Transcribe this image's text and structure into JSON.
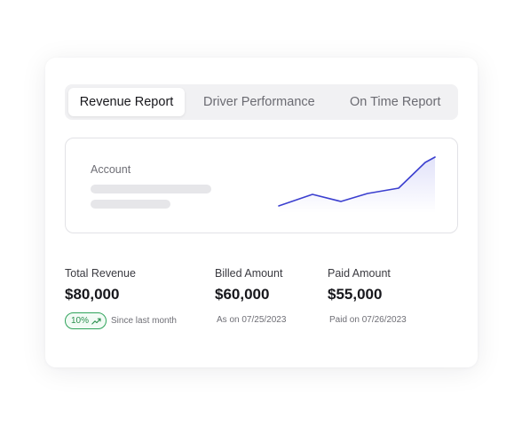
{
  "tabs": [
    {
      "label": "Revenue Report",
      "active": true
    },
    {
      "label": "Driver Performance",
      "active": false
    },
    {
      "label": "On Time Report",
      "active": false
    }
  ],
  "account": {
    "label": "Account",
    "sparkline_color": "#3b3fcf"
  },
  "metrics": {
    "total_revenue": {
      "label": "Total Revenue",
      "value": "$80,000",
      "badge": "10%",
      "badge_icon": "trend-up-icon",
      "badge_color": "#2fa35a",
      "note": "Since last month"
    },
    "billed_amount": {
      "label": "Billed Amount",
      "value": "$60,000",
      "note": "As on 07/25/2023"
    },
    "paid_amount": {
      "label": "Paid Amount",
      "value": "$55,000",
      "note": "Paid on 07/26/2023"
    }
  }
}
